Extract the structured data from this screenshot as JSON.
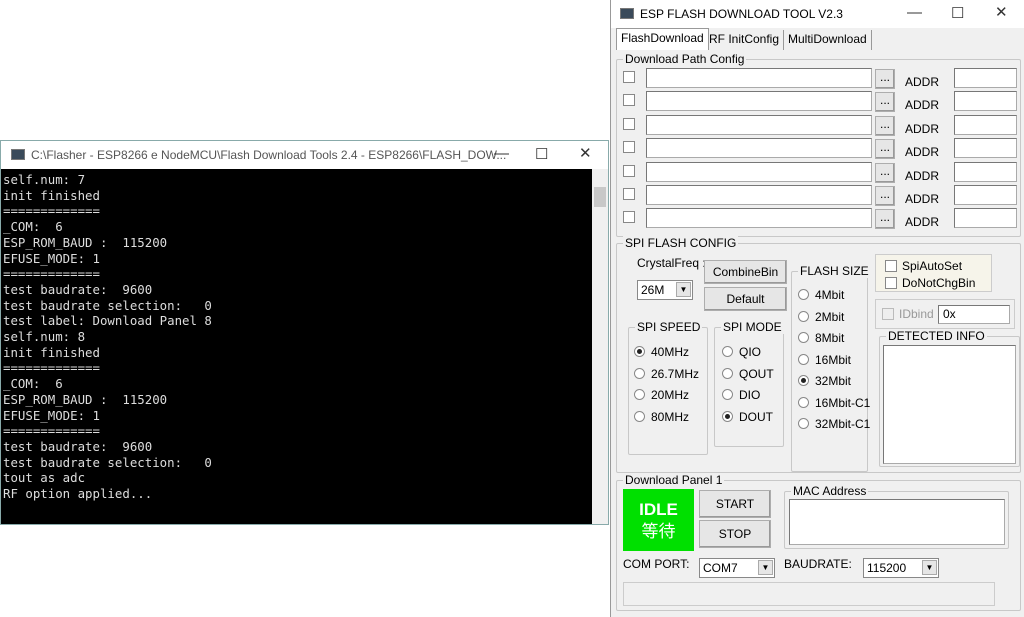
{
  "console": {
    "title": "C:\\Flasher - ESP8266 e NodeMCU\\Flash Download Tools 2.4 - ESP8266\\FLASH_DOW...",
    "lines": [
      "self.num: 7",
      "init finished",
      "=============",
      "_COM:  6",
      "ESP_ROM_BAUD :  115200",
      "EFUSE_MODE: 1",
      "=============",
      "test baudrate:  9600",
      "test baudrate selection:   0",
      "test label: Download Panel 8",
      "self.num: 8",
      "init finished",
      "=============",
      "_COM:  6",
      "ESP_ROM_BAUD :  115200",
      "EFUSE_MODE: 1",
      "=============",
      "test baudrate:  9600",
      "test baudrate selection:   0",
      "tout as adc",
      "RF option applied..."
    ]
  },
  "tool": {
    "title": "ESP FLASH DOWNLOAD TOOL V2.3",
    "tabs": [
      "FlashDownload",
      "RF InitConfig",
      "MultiDownload"
    ],
    "path_config": {
      "legend": "Download Path Config",
      "browse_label": "...",
      "addr_label": "ADDR",
      "rows": [
        {
          "path": "",
          "addr": ""
        },
        {
          "path": "",
          "addr": ""
        },
        {
          "path": "",
          "addr": ""
        },
        {
          "path": "",
          "addr": ""
        },
        {
          "path": "",
          "addr": ""
        },
        {
          "path": "",
          "addr": ""
        },
        {
          "path": "",
          "addr": ""
        }
      ]
    },
    "spi": {
      "legend": "SPI FLASH CONFIG",
      "crystal_label": "CrystalFreq :",
      "crystal_value": "26M",
      "combine_label": "CombineBin",
      "default_label": "Default",
      "speed_legend": "SPI SPEED",
      "speeds": [
        "40MHz",
        "26.7MHz",
        "20MHz",
        "80MHz"
      ],
      "speed_selected": "40MHz",
      "mode_legend": "SPI MODE",
      "modes": [
        "QIO",
        "QOUT",
        "DIO",
        "DOUT"
      ],
      "mode_selected": "DOUT",
      "size_legend": "FLASH SIZE",
      "sizes": [
        "4Mbit",
        "2Mbit",
        "8Mbit",
        "16Mbit",
        "32Mbit",
        "16Mbit-C1",
        "32Mbit-C1"
      ],
      "size_selected": "32Mbit",
      "spi_auto_set": "SpiAutoSet",
      "do_not_chg_bin": "DoNotChgBin",
      "idbind_label": "IDbind",
      "idbind_value": "0x",
      "detected_legend": "DETECTED INFO",
      "detected_info": ""
    },
    "panel": {
      "legend": "Download Panel 1",
      "status_en": "IDLE",
      "status_cn": "等待",
      "status_color": "#00e000",
      "start_label": "START",
      "stop_label": "STOP",
      "mac_legend": "MAC Address",
      "mac_value": "",
      "com_label": "COM PORT:",
      "com_value": "COM7",
      "baud_label": "BAUDRATE:",
      "baud_value": "115200"
    }
  }
}
